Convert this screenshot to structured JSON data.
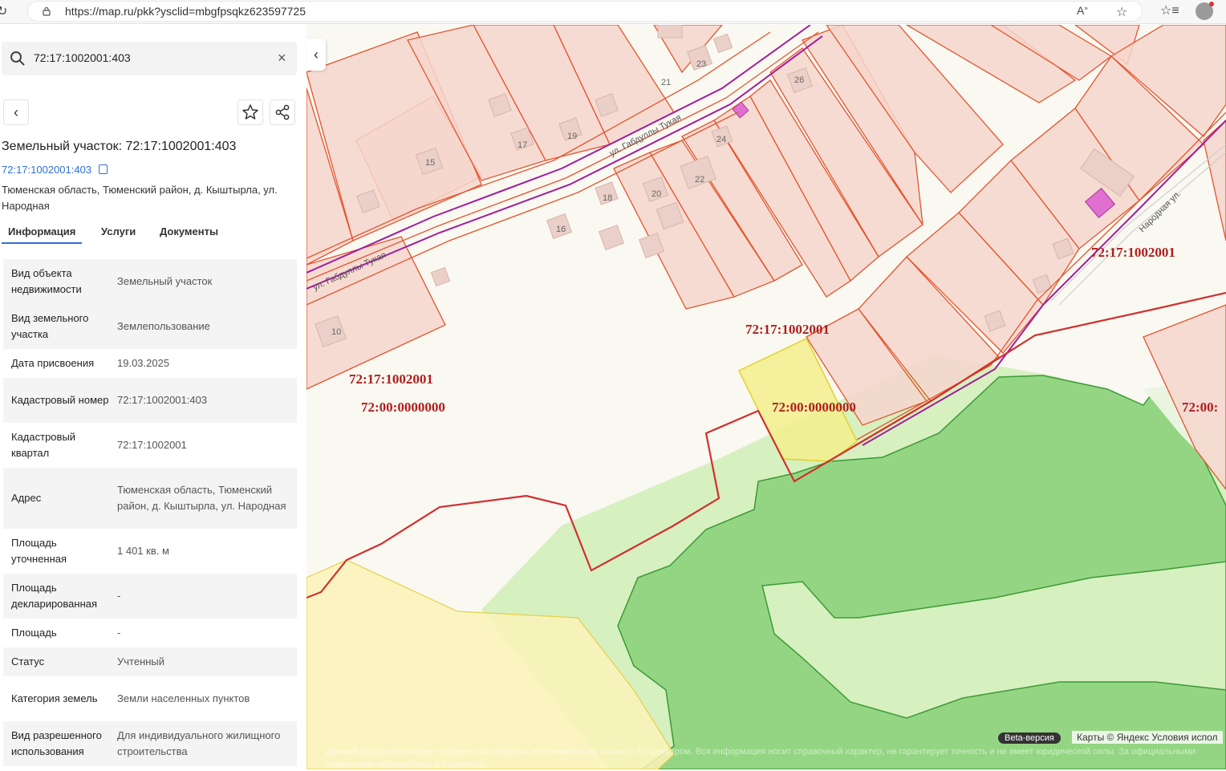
{
  "browser": {
    "url": "https://map.ru/pkk?ysclid=mbgfpsqkz623597725"
  },
  "search": {
    "value": "72:17:1002001:403"
  },
  "object": {
    "title": "Земельный участок: 72:17:1002001:403",
    "link": "72:17:1002001:403",
    "address": "Тюменская область, Тюменский район, д. Кыштырла, ул. Народная"
  },
  "tabs": [
    "Информация",
    "Услуги",
    "Документы"
  ],
  "properties": [
    {
      "key": "Вид объекта недвижимости",
      "value": "Земельный участок"
    },
    {
      "key": "Вид земельного участка",
      "value": "Землепользование"
    },
    {
      "key": "Дата присвоения",
      "value": "19.03.2025"
    },
    {
      "key": "Кадастровый номер",
      "value": "72:17:1002001:403"
    },
    {
      "key": "Кадастровый квартал",
      "value": "72:17:1002001"
    },
    {
      "key": "Адрес",
      "value": "Тюменская область, Тюменский район, д. Кыштырла, ул. Народная"
    },
    {
      "key": "Площадь уточненная",
      "value": "1 401 кв. м"
    },
    {
      "key": "Площадь декларированная",
      "value": "-"
    },
    {
      "key": "Площадь",
      "value": "-"
    },
    {
      "key": "Статус",
      "value": "Учтенный"
    },
    {
      "key": "Категория земель",
      "value": "Земли населенных пунктов"
    },
    {
      "key": "Вид разрешенного использования",
      "value": "Для индивидуального жилищного строительства"
    }
  ],
  "map": {
    "labels": {
      "q1": "72:17:1002001",
      "q2": "72:17:1002001",
      "q3": "72:17:1002001",
      "z1": "72:00:0000000",
      "z2": "72:00:0000000",
      "z3": "72:00:"
    },
    "house_numbers": [
      "10",
      "15",
      "16",
      "17",
      "18",
      "19",
      "20",
      "21",
      "22",
      "23",
      "24",
      "26"
    ],
    "street1": "ул. Габдуллы Тукая",
    "street2": "ул. Габдуллы Тукая",
    "street3": "Народная ул.",
    "beta": "Beta-версия",
    "attribution": "Карты © Яндекс   Условия испол",
    "disclaimer": "Данный ресурс использует сведения из открытых источников и не связан с Росреестром. Вся информация носит справочный характер, не гарантирует точность и не имеет юридической силы. За официальными сведениями обращайтесь в Росреестр."
  },
  "colors": {
    "accent": "#2f6fd6",
    "parcel_fill": "#f6d6cc",
    "parcel_stroke": "#e3552f",
    "quarter_stroke": "#d0302e",
    "forest": "#94d584",
    "meadow": "#d6f0c0",
    "selected": "#f3ee8c"
  }
}
